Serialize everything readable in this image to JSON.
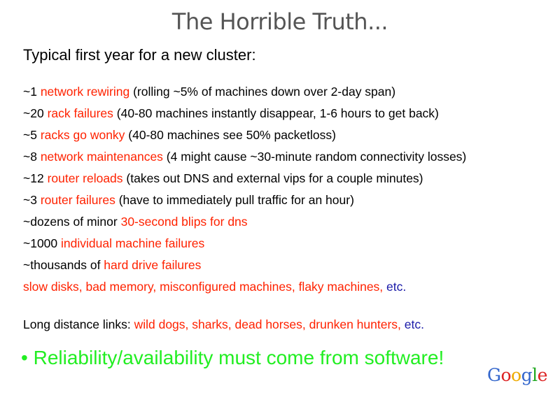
{
  "slide": {
    "title": "The Horrible Truth...",
    "subtitle": "Typical first year for a new cluster:",
    "items": [
      {
        "prefix": "~1 ",
        "highlight": "network rewiring",
        "suffix": " (rolling ~5% of machines down over 2-day span)"
      },
      {
        "prefix": "~20 ",
        "highlight": "rack failures",
        "suffix": " (40-80 machines instantly disappear, 1-6 hours to get back)"
      },
      {
        "prefix": "~5 ",
        "highlight": "racks go wonky",
        "suffix": " (40-80 machines see 50% packetloss)"
      },
      {
        "prefix": "~8 ",
        "highlight": "network maintenances",
        "suffix": " (4 might cause ~30-minute random connectivity losses)"
      },
      {
        "prefix": "~12 ",
        "highlight": "router reloads",
        "suffix": " (takes out DNS and external vips for a couple minutes)"
      },
      {
        "prefix": "~3 ",
        "highlight": "router failures",
        "suffix": " (have to immediately pull traffic for an hour)"
      },
      {
        "prefix": "~dozens of minor ",
        "highlight": "30-second blips for dns",
        "suffix": ""
      },
      {
        "prefix": "~1000 ",
        "highlight": "individual machine failures",
        "suffix": ""
      },
      {
        "prefix": "~thousands of ",
        "highlight": "hard drive failures",
        "suffix": ""
      }
    ],
    "misc": {
      "highlight": "slow disks, bad memory, misconfigured machines, flaky machines, ",
      "etc": "etc."
    },
    "long_distance": {
      "prefix": "Long distance links: ",
      "highlight": "wild dogs, sharks, dead horses, drunken hunters, ",
      "etc": "etc."
    },
    "bullet_symbol": "•",
    "bullet_text": "Reliability/availability must come from software!",
    "logo_letters": [
      {
        "ch": "G",
        "color": "#3366cc"
      },
      {
        "ch": "o",
        "color": "#dd2222"
      },
      {
        "ch": "o",
        "color": "#eeaa00"
      },
      {
        "ch": "g",
        "color": "#3366cc"
      },
      {
        "ch": "l",
        "color": "#22aa22"
      },
      {
        "ch": "e",
        "color": "#dd2222"
      }
    ],
    "colors": {
      "highlight": "#ff2200",
      "etc": "#1a1aa8",
      "bullet": "#22ee22",
      "title": "#555555"
    }
  }
}
